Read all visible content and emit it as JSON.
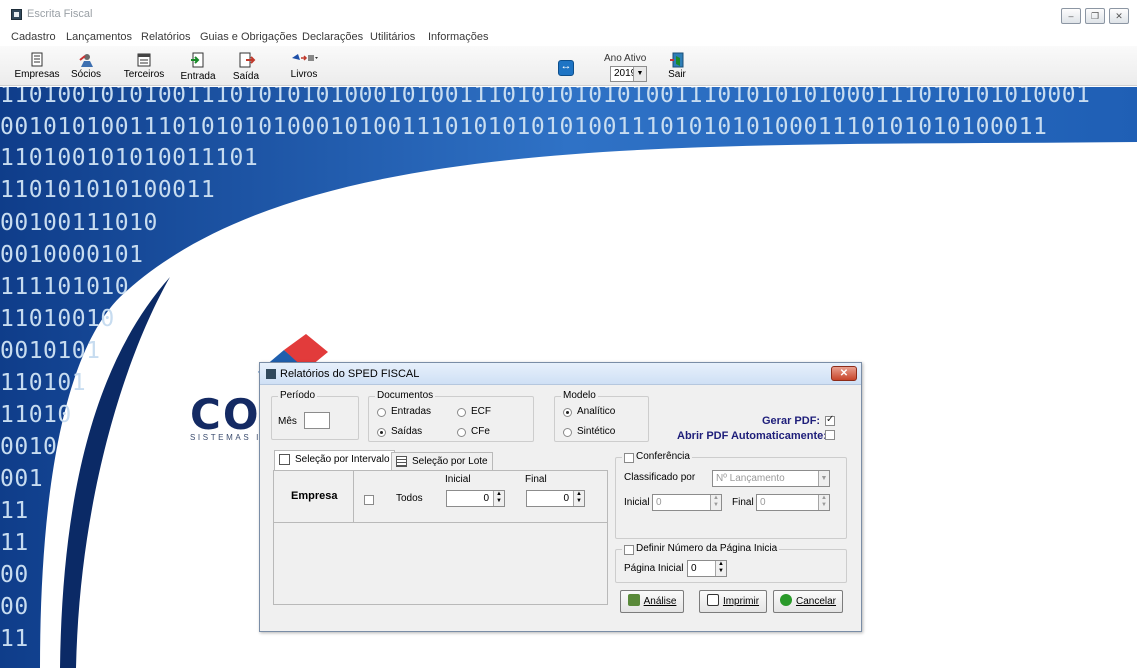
{
  "window": {
    "title": "Escrita Fiscal"
  },
  "menu": [
    "Cadastro",
    "Lançamentos",
    "Relatórios",
    "Guias e Obrigações",
    "Declarações",
    "Utilitários",
    "Informações"
  ],
  "toolbar": {
    "empresas": "Empresas",
    "socios": "Sócios",
    "terceiros": "Terceiros",
    "entrada": "Entrada",
    "saida": "Saída",
    "livros": "Livros",
    "ano_ativo_label": "Ano Ativo",
    "ano_ativo_value": "2019",
    "sair": "Sair"
  },
  "background": {
    "binary_rows": [
      "1101001010100111010101010001010011101010101010011101010101000111010101010001",
      "0010101001110101010100010100111010101010100111010101010001110101010100011",
      "110100101010011101",
      "110101010100011",
      "00100111010",
      "0010000101",
      "111101010",
      "11010010",
      "0010101",
      "110101",
      "11010",
      "0010",
      "001",
      "11",
      "11",
      "00",
      "00",
      "11"
    ],
    "logo_text": "COPAN",
    "logo_subtitle": "SISTEMAS INTEGRADOS"
  },
  "dialog": {
    "title": "Relatórios do SPED FISCAL",
    "periodo": {
      "legend": "Período",
      "mes_label": "Mês",
      "mes_value": ""
    },
    "documentos": {
      "legend": "Documentos",
      "options": [
        {
          "label": "Entradas",
          "selected": false
        },
        {
          "label": "ECF",
          "selected": false
        },
        {
          "label": "Saídas",
          "selected": true
        },
        {
          "label": "CFe",
          "selected": false
        }
      ]
    },
    "modelo": {
      "legend": "Modelo",
      "options": [
        {
          "label": "Analítico",
          "selected": true
        },
        {
          "label": "Sintético",
          "selected": false
        }
      ]
    },
    "gerar_pdf_label": "Gerar PDF:",
    "gerar_pdf_checked": true,
    "abrir_pdf_label": "Abrir PDF Automaticamente:",
    "abrir_pdf_checked": false,
    "tabs": [
      {
        "label": "Seleção por Intervalo",
        "active": true
      },
      {
        "label": "Seleção por Lote",
        "active": false
      }
    ],
    "intervalo": {
      "empresa_label": "Empresa",
      "todos_label": "Todos",
      "todos_checked": false,
      "inicial_label": "Inicial",
      "inicial_value": "0",
      "final_label": "Final",
      "final_value": "0"
    },
    "conferencia": {
      "legend": "Conferência",
      "checked": false,
      "classificado_label": "Classificado por",
      "classificado_value": "Nº Lançamento",
      "inicial_label": "Inicial",
      "inicial_value": "0",
      "final_label": "Final",
      "final_value": "0"
    },
    "pagina": {
      "legend": "Definir Número da  Página Inicia",
      "checked": false,
      "label": "Página Inicial",
      "value": "0"
    },
    "buttons": {
      "analise": "Análise",
      "imprimir": "Imprimir",
      "cancelar": "Cancelar"
    }
  }
}
